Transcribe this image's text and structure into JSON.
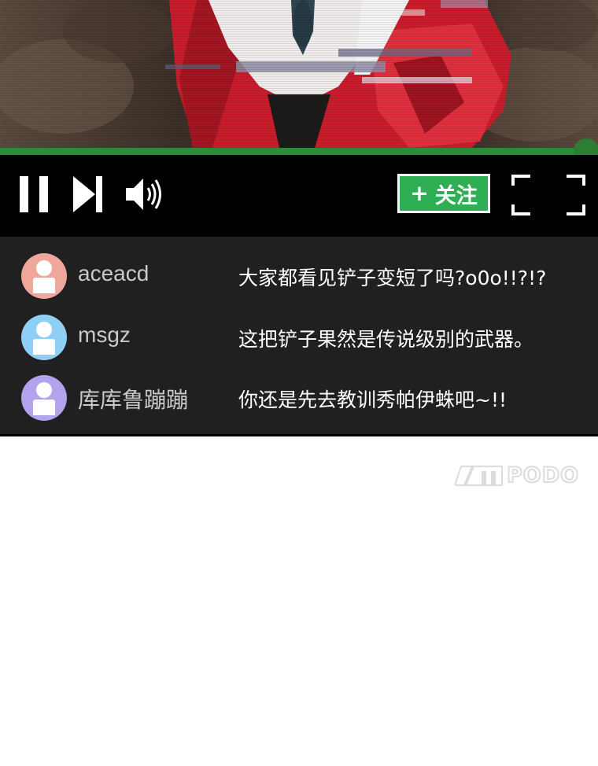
{
  "player": {
    "progress": 0.98,
    "accent_color": "#2f8a3a",
    "controls": {
      "pause_icon": "pause-icon",
      "next_icon": "skip-next-icon",
      "volume_icon": "volume-icon",
      "fullscreen_icon": "fullscreen-icon"
    },
    "follow_button": {
      "plus": "+",
      "label": "关注",
      "color": "#2fae53"
    }
  },
  "comments": [
    {
      "username": "aceacd",
      "message": "大家都看见铲子变短了吗?o0o!!?!?",
      "avatar_color": "#f0a79b"
    },
    {
      "username": "msgz",
      "message": "这把铲子果然是传说级别的武器。",
      "avatar_color": "#8fcff6"
    },
    {
      "username": "库库鲁蹦蹦",
      "message": "你还是先去教训秀帕伊蛛吧~!!",
      "avatar_color": "#b3a3ec"
    }
  ],
  "watermark": {
    "text": "PODO"
  }
}
